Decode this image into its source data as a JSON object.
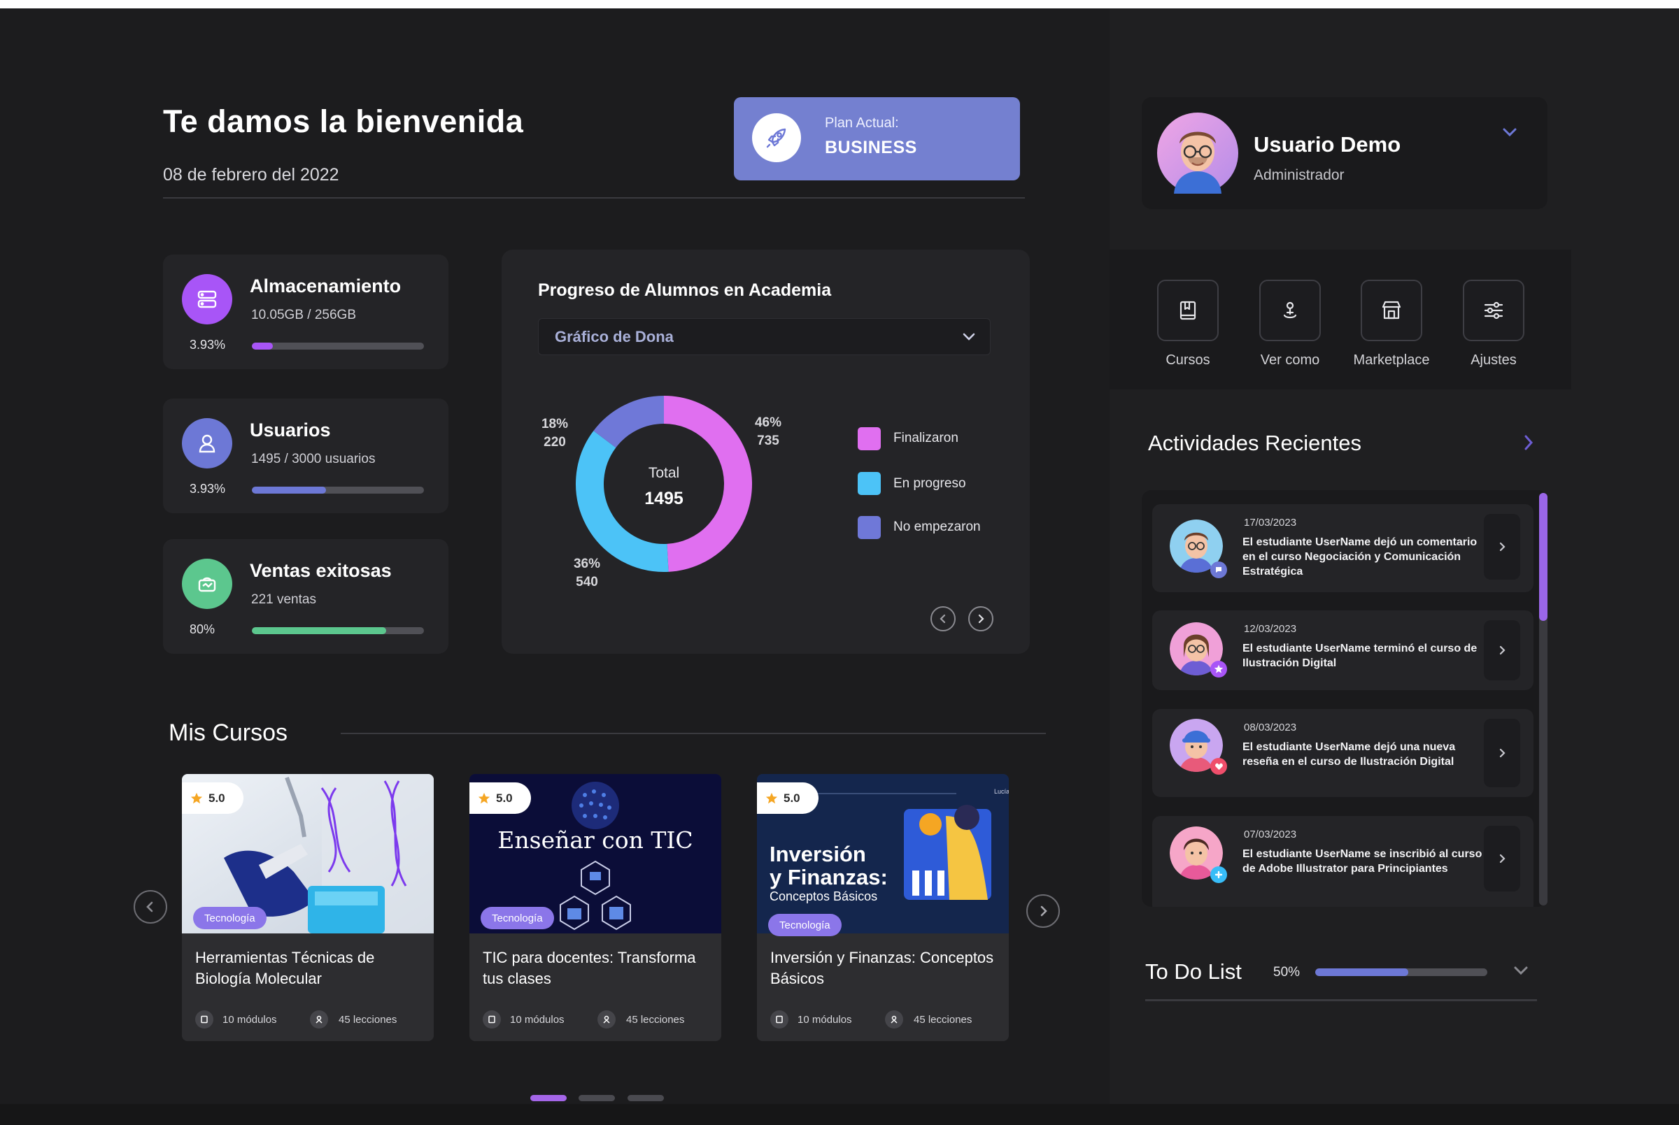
{
  "header": {
    "title": "Te damos la bienvenida",
    "date": "08 de febrero del 2022",
    "plan_label": "Plan Actual:",
    "plan_value": "BUSINESS",
    "plan_icon": "rocket-icon"
  },
  "stats": [
    {
      "title": "Almacenamiento",
      "subtitle": "10.05GB / 256GB",
      "percent_label": "3.93%",
      "fill": 0.12,
      "color": "#a855f7",
      "icon": "storage-icon"
    },
    {
      "title": "Usuarios",
      "subtitle": "1495 / 3000 usuarios",
      "percent_label": "3.93%",
      "fill": 0.43,
      "color": "#6d78d6",
      "icon": "user-icon"
    },
    {
      "title": "Ventas exitosas",
      "subtitle": "221 ventas",
      "percent_label": "80%",
      "fill": 0.78,
      "color": "#5cc78e",
      "icon": "sales-icon"
    }
  ],
  "progress_chart": {
    "title": "Progreso de Alumnos en Academia",
    "dropdown_value": "Gráfico de Dona",
    "center_label": "Total",
    "center_value": "1495",
    "labels": {
      "finalizaron": {
        "pct": "46%",
        "count": "735"
      },
      "en_progreso": {
        "pct": "36%",
        "count": "540"
      },
      "no_empezaron": {
        "pct": "18%",
        "count": "220"
      }
    },
    "legend": [
      "Finalizaron",
      "En progreso",
      "No empezaron"
    ]
  },
  "chart_data": {
    "type": "pie",
    "categories": [
      "Finalizaron",
      "En progreso",
      "No empezaron"
    ],
    "values": [
      735,
      540,
      220
    ],
    "percentages": [
      46,
      36,
      18
    ],
    "colors": [
      "#e06ff0",
      "#4cc3f7",
      "#6f78d8"
    ],
    "title": "Progreso de Alumnos en Academia",
    "total": 1495
  },
  "courses": {
    "title": "Mis Cursos",
    "items": [
      {
        "rating": "5.0",
        "tag": "Tecnología",
        "title": "Herramientas Técnicas de Biología Molecular",
        "modules": "10 módulos",
        "lessons": "45 lecciones",
        "image_text": ""
      },
      {
        "rating": "5.0",
        "tag": "Tecnología",
        "title": "TIC para docentes: Transforma tus clases",
        "modules": "10 módulos",
        "lessons": "45 lecciones",
        "image_text": "Enseñar con TIC"
      },
      {
        "rating": "5.0",
        "tag": "Tecnología",
        "title": "Inversión y Finanzas: Conceptos Básicos",
        "modules": "10 módulos",
        "lessons": "45 lecciones",
        "image_text_1": "Inversión",
        "image_text_2": "y Finanzas:",
        "image_text_3": "Conceptos Básicos",
        "image_corner": "Lucía"
      }
    ]
  },
  "user": {
    "name": "Usuario Demo",
    "role": "Administrador"
  },
  "quick_actions": [
    {
      "label": "Cursos",
      "icon": "book-icon"
    },
    {
      "label": "Ver como",
      "icon": "view-as-icon"
    },
    {
      "label": "Marketplace",
      "icon": "store-icon"
    },
    {
      "label": "Ajustes",
      "icon": "sliders-icon"
    }
  ],
  "activities": {
    "title": "Actividades Recientes",
    "items": [
      {
        "date": "17/03/2023",
        "text": "El estudiante UserName dejó un comentario en el curso Negociación y Comunicación Estratégica",
        "badge": "comment-icon",
        "badge_color": "#6d78d6"
      },
      {
        "date": "12/03/2023",
        "text": "El estudiante UserName terminó el curso de Ilustración Digital",
        "badge": "star-icon",
        "badge_color": "#a855f7"
      },
      {
        "date": "08/03/2023",
        "text": "El estudiante UserName dejó una nueva reseña en el curso de Ilustración Digital",
        "badge": "heart-icon",
        "badge_color": "#ef4e6b"
      },
      {
        "date": "07/03/2023",
        "text": "El estudiante UserName se inscribió al curso de Adobe Illustrator para Principiantes",
        "badge": "plus-icon",
        "badge_color": "#38bdf8"
      }
    ]
  },
  "todo": {
    "title": "To Do List",
    "percent_label": "50%",
    "fill": 0.54
  }
}
